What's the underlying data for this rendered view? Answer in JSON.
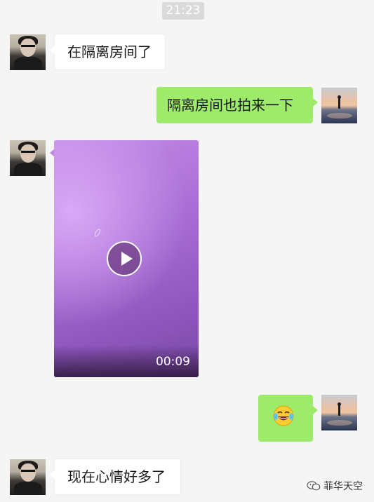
{
  "timestamp": "21:23",
  "messages": [
    {
      "side": "incoming",
      "type": "text",
      "text": "在隔离房间了"
    },
    {
      "side": "outgoing",
      "type": "text",
      "text": "隔离房间也拍来一下"
    },
    {
      "side": "incoming",
      "type": "video",
      "duration": "00:09",
      "play_icon": "play-icon"
    },
    {
      "side": "outgoing",
      "type": "emoji",
      "emoji_icon": "tears-of-joy-emoji-icon"
    },
    {
      "side": "incoming",
      "type": "text",
      "text": "现在心情好多了"
    }
  ],
  "watermark": {
    "text": "菲华天空",
    "icon": "wechat-icon"
  },
  "colors": {
    "background": "#f5f5f5",
    "incoming_bubble": "#ffffff",
    "outgoing_bubble": "#9eea6a",
    "timestamp_bg": "#dadada"
  }
}
